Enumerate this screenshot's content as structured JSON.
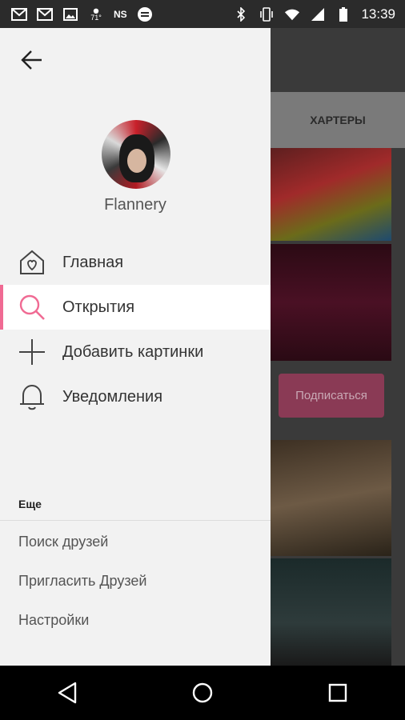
{
  "status_bar": {
    "left_icons": [
      "gmail-icon",
      "gmail-icon",
      "image-icon",
      "weather-icon",
      "ns-label",
      "sync-icon"
    ],
    "weather_temp": "71°",
    "ns_label": "NS",
    "right_icons": [
      "bluetooth-icon",
      "vibrate-icon",
      "wifi-icon",
      "signal-icon",
      "battery-icon"
    ],
    "time": "13:39"
  },
  "background": {
    "header_label": "ХАРТЕРЫ",
    "subscribe_button": "Подписаться"
  },
  "drawer": {
    "username": "Flannery",
    "menu": [
      {
        "label": "Главная",
        "icon": "home-heart-icon",
        "active": false
      },
      {
        "label": "Открытия",
        "icon": "search-icon",
        "active": true
      },
      {
        "label": "Добавить картинки",
        "icon": "plus-icon",
        "active": false
      },
      {
        "label": "Уведомления",
        "icon": "bell-icon",
        "active": false
      }
    ],
    "more_title": "Еще",
    "more_items": [
      "Поиск друзей",
      "Пригласить Друзей",
      "Настройки"
    ]
  },
  "colors": {
    "accent": "#f06a93",
    "drawer_bg": "#f2f2f2"
  }
}
